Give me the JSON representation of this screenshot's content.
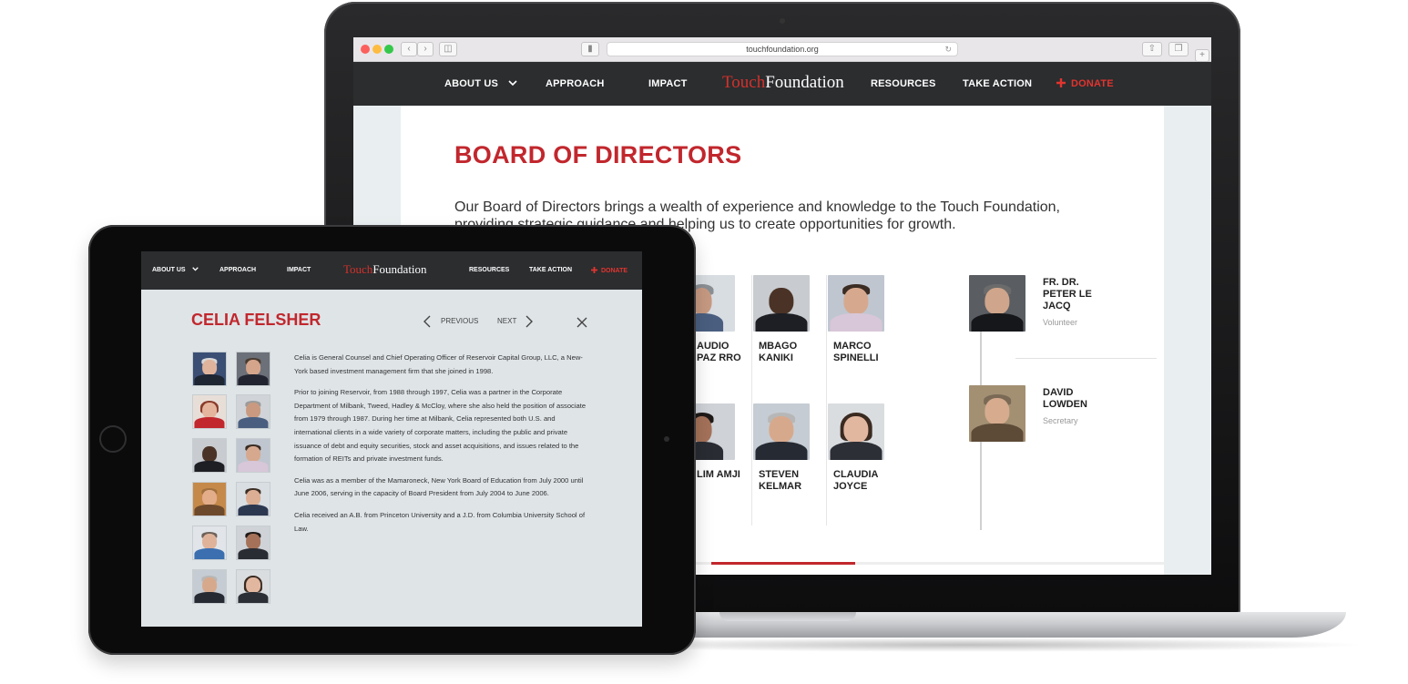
{
  "laptop": {
    "browser": {
      "url": "touchfoundation.org"
    },
    "nav": {
      "about_us": "ABOUT US",
      "approach": "APPROACH",
      "impact": "IMPACT",
      "logo_part1": "Touch",
      "logo_part2": "Foundation",
      "resources": "RESOURCES",
      "take_action": "TAKE ACTION",
      "donate": "DONATE"
    },
    "page": {
      "title": "BOARD OF DIRECTORS",
      "intro": "Our Board of Directors brings a wealth of experience and knowledge to the Touch Foundation, providing strategic guidance and helping us to create opportunities for growth."
    },
    "directors": [
      {
        "name": "AUDIO PAZ RRO",
        "role": ""
      },
      {
        "name": "MBAGO KANIKI",
        "role": ""
      },
      {
        "name": "MARCO SPINELLI",
        "role": ""
      },
      {
        "name": "LIM AMJI",
        "role": ""
      },
      {
        "name": "STEVEN KELMAR",
        "role": ""
      },
      {
        "name": "CLAUDIA JOYCE",
        "role": ""
      }
    ],
    "officers": [
      {
        "name": "FR. DR. PETER LE JACQ",
        "role": "Volunteer"
      },
      {
        "name": "DAVID LOWDEN",
        "role": "Secretary"
      }
    ]
  },
  "tablet": {
    "nav": {
      "about_us": "ABOUT US",
      "approach": "APPROACH",
      "impact": "IMPACT",
      "logo_part1": "Touch",
      "logo_part2": "Foundation",
      "resources": "RESOURCES",
      "take_action": "TAKE ACTION",
      "donate": "DONATE"
    },
    "profile": {
      "name": "CELIA FELSHER",
      "previous": "PREVIOUS",
      "next": "NEXT",
      "bio": [
        "Celia is General Counsel and Chief Operating Officer of Reservoir Capital Group, LLC, a New-York based investment management firm that she joined in 1998.",
        "Prior to joining Reservoir, from 1988 through 1997, Celia was a partner in the Corporate Department of Milbank, Tweed, Hadley & McCloy, where she also held the position of associate from 1979 through 1987. During her time at Milbank, Celia represented both U.S. and international clients in a wide variety of corporate matters, including the public and private issuance of debt and equity securities, stock and asset acquisitions, and issues related to the formation of REITs and private investment funds.",
        "Celia was as a member of the Mamaroneck, New York Board of Education from July 2000 until June 2006, serving in the capacity of Board President from July 2004 to June 2006.",
        "Celia received an A.B. from Princeton University and a J.D. from Columbia University School of Law."
      ]
    }
  },
  "colors": {
    "brand_red": "#c1272d",
    "nav_bg": "#2b2d2f",
    "donate_red": "#e2342f"
  }
}
